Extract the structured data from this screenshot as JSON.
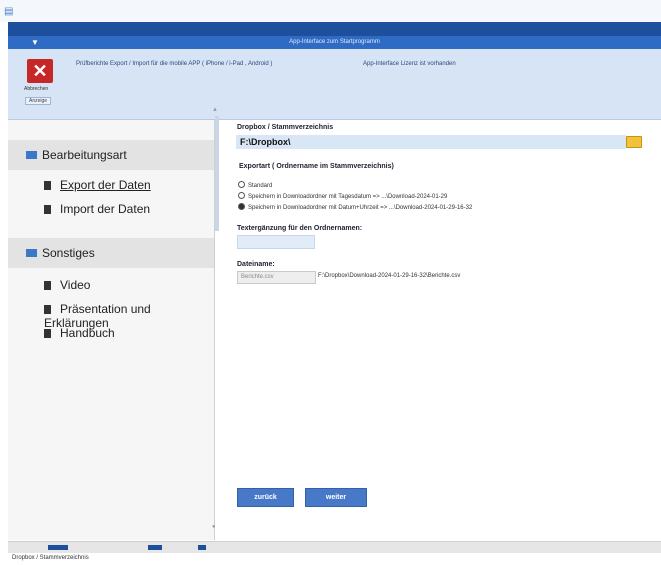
{
  "window": {
    "title": "App-Interface zum Startprogramm",
    "header_left": "▼"
  },
  "ribbon": {
    "close_label": "Abbrechen",
    "group_label": "Anzeige",
    "info_text": "Prüfberichte Export / Import für die mobile APP ( iPhone / i-Pad , Android )",
    "license_text": "App-Interface Lizenz ist vorhanden"
  },
  "sidebar": {
    "section1": "Bearbeitungsart",
    "items1": [
      "Export der Daten",
      "Import  der Daten"
    ],
    "section2": "Sonstiges",
    "items2": [
      "Video",
      "Präsentation und Erklärungen",
      "Handbuch"
    ]
  },
  "main": {
    "dropbox_label": "Dropbox / Stammverzeichnis",
    "dropbox_path": "F:\\Dropbox\\",
    "exportart_label": "Exportart ( Ordnername im Stammverzeichnis)",
    "options": [
      {
        "label": "Standard",
        "selected": false
      },
      {
        "label": "Speichern in Downloadordner mit Tagesdatum  =>  ...\\Download-2024-01-29",
        "selected": false
      },
      {
        "label": "Speichern in Downloadordner mit Datum+Uhrzeit =>  ...\\Download-2024-01-29-16-32",
        "selected": true
      }
    ],
    "text_label": "Textergänzung für den Ordnernamen:",
    "text_value": "",
    "filename_label": "Dateiname:",
    "filename_value": "Berichte.csv",
    "full_path": "F:\\Dropbox\\Download-2024-01-29-16-32\\Berichte.csv",
    "back_button": "zurück",
    "next_button": "weiter"
  },
  "statusbar": {
    "text": "Dropbox / Stammverzeichnis"
  }
}
